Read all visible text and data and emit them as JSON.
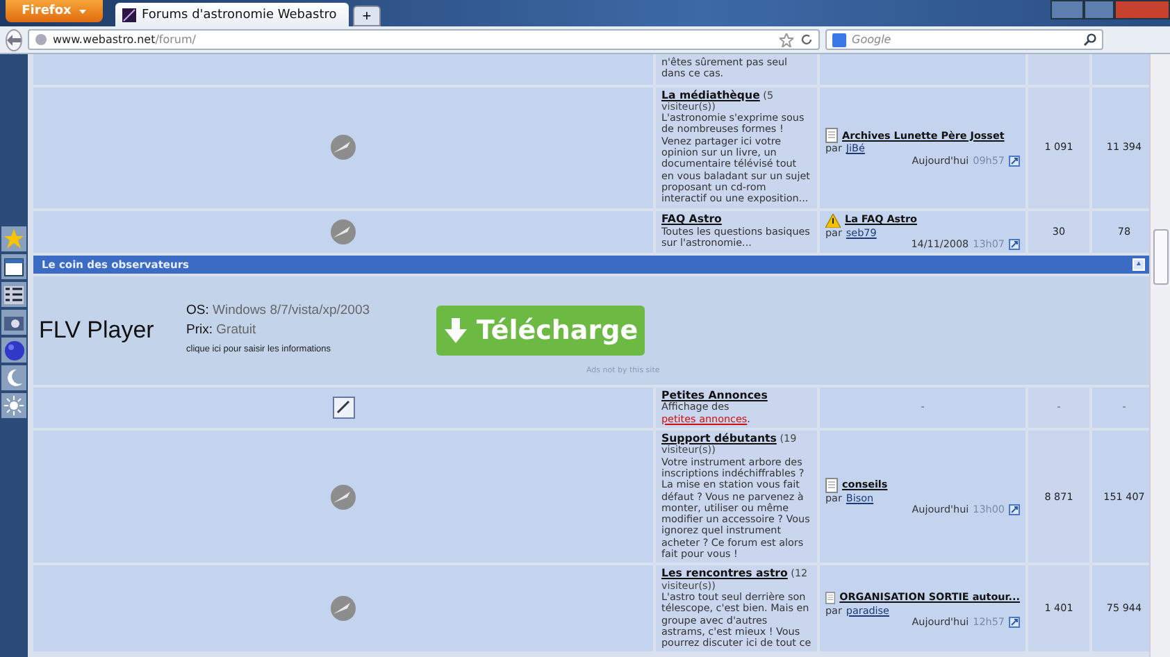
{
  "browser": {
    "menu_button": "Firefox",
    "tabs": [
      {
        "title": "Forums d'astronomie Webastro",
        "selected": true
      }
    ],
    "new_tab": "+",
    "url_host": "www.webastro.net",
    "url_path": "/forum/",
    "search_placeholder": "Google"
  },
  "rows": [
    {
      "kind": "partial",
      "description": "n'êtes sûrement pas seul dans ce cas."
    },
    {
      "kind": "forum",
      "title": "La médiathèque",
      "visitors": "(5 visiteur(s))",
      "description": "L'astronomie s'exprime sous de nombreuses formes ! Venez partager ici votre opinion sur un livre, un documentaire télévisé tout en vous baladant sur un sujet proposant un cd-rom interactif ou une exposition...",
      "last_post": {
        "kind": "page",
        "title": "Archives Lunette Père Josset",
        "by": "par",
        "author": "JiBé",
        "date": "Aujourd'hui",
        "time": "09h57"
      },
      "topics": "1 091",
      "posts": "11 394"
    },
    {
      "kind": "forum",
      "title": "FAQ Astro",
      "description": "Toutes les questions basiques sur l'astronomie...",
      "last_post": {
        "kind": "warning",
        "title": "La FAQ Astro",
        "by": "par",
        "author": "seb79",
        "date": "14/11/2008",
        "time": "13h07"
      },
      "topics": "30",
      "posts": "78"
    },
    {
      "kind": "category",
      "title": "Le coin des observateurs",
      "collapse": "▲"
    },
    {
      "kind": "ad",
      "product": "FLV Player",
      "os_label": "OS:",
      "os": "Windows 8/7/vista/xp/2003",
      "price_label": "Prix:",
      "price": "Gratuit",
      "hint": "clique ici pour saisir les informations",
      "button": "Télécharge",
      "note": "Ads not by this site"
    },
    {
      "kind": "link",
      "title": "Petites Annonces",
      "description": "Affichage des",
      "link": "petites annonces",
      "after": ".",
      "last": "-",
      "topics": "-",
      "posts": "-"
    },
    {
      "kind": "forum",
      "title": "Support débutants",
      "visitors": "(19 visiteur(s))",
      "description": "Votre instrument arbore des inscriptions indéchiffrables ? La mise en station vous fait défaut ? Vous ne parvenez à monter, utiliser ou même modifier un accessoire ? Vous ignorez quel instrument acheter ? Ce forum est alors fait pour vous !",
      "last_post": {
        "kind": "page",
        "title": "conseils",
        "by": "par",
        "author": "Bison",
        "date": "Aujourd'hui",
        "time": "13h00"
      },
      "topics": "8 871",
      "posts": "151 407"
    },
    {
      "kind": "forum",
      "title": "Les rencontres astro",
      "visitors": "(12 visiteur(s))",
      "description": "L'astro tout seul derrière son télescope, c'est bien. Mais en groupe avec d'autres astrams, c'est mieux ! Vous pourrez discuter ici de tout ce",
      "last_post": {
        "kind": "page",
        "title": "ORGANISATION SORTIE autour...",
        "by": "par",
        "author": "paradise",
        "date": "Aujourd'hui",
        "time": "12h57"
      },
      "topics": "1 401",
      "posts": "75 944"
    }
  ]
}
